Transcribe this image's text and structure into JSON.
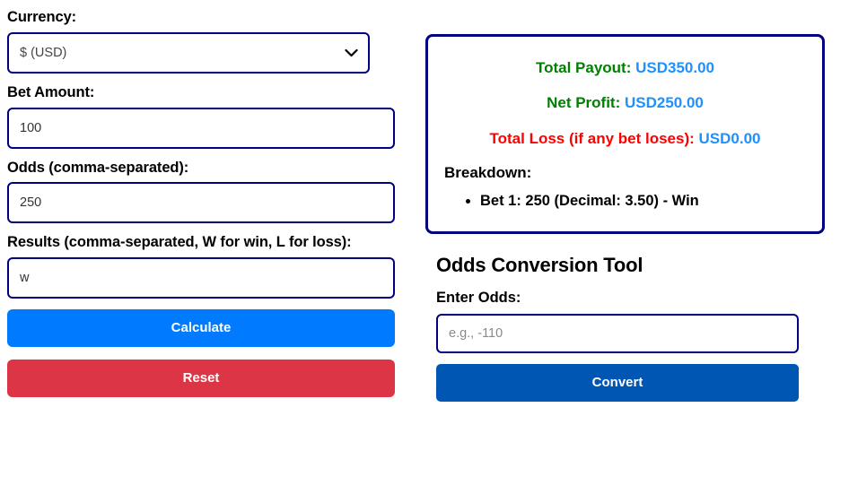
{
  "form": {
    "currency": {
      "label": "Currency:",
      "selected": "$ (USD)",
      "options": [
        "$ (USD)"
      ],
      "icon": "chevron-down-icon"
    },
    "bet_amount": {
      "label": "Bet Amount:",
      "value": "100",
      "placeholder": ""
    },
    "odds": {
      "label": "Odds (comma-separated):",
      "value": "250",
      "placeholder": ""
    },
    "results": {
      "label": "Results (comma-separated, W for win, L for loss):",
      "value": "w",
      "placeholder": ""
    },
    "calculate_label": "Calculate",
    "reset_label": "Reset"
  },
  "results_panel": {
    "total_payout": {
      "label": "Total Payout:",
      "value": "USD350.00"
    },
    "net_profit": {
      "label": "Net Profit:",
      "value": "USD250.00"
    },
    "total_loss": {
      "label": "Total Loss (if any bet loses):",
      "value": "USD0.00"
    },
    "breakdown_title": "Breakdown:",
    "breakdown_items": [
      "Bet 1: 250 (Decimal: 3.50) - Win"
    ]
  },
  "conversion": {
    "title": "Odds Conversion Tool",
    "enter_odds_label": "Enter Odds:",
    "odds_value": "",
    "odds_placeholder": "e.g., -110",
    "convert_label": "Convert"
  },
  "colors": {
    "border_navy": "#000080",
    "label_green": "#008000",
    "label_red": "#ff0000",
    "value_blue": "#1e90ff",
    "btn_primary": "#007bff",
    "btn_danger": "#dc3545",
    "btn_convert": "#0056b3"
  }
}
